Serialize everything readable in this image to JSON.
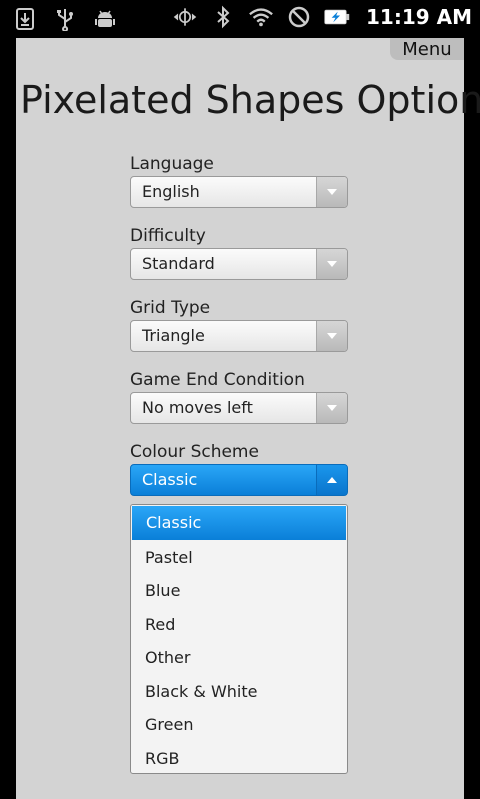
{
  "status_bar": {
    "time": "11:19 AM",
    "left_icons": [
      "download-icon",
      "usb-icon",
      "android-debug-icon"
    ],
    "right_icons": [
      "data-sync-icon",
      "bluetooth-icon",
      "wifi-icon",
      "no-signal-icon",
      "battery-charging-icon"
    ]
  },
  "menu": {
    "label": "Menu"
  },
  "page": {
    "title": "Pixelated Shapes Options"
  },
  "fields": [
    {
      "label": "Language",
      "value": "English"
    },
    {
      "label": "Difficulty",
      "value": "Standard"
    },
    {
      "label": "Grid Type",
      "value": "Triangle"
    },
    {
      "label": "Game End Condition",
      "value": "No moves left"
    },
    {
      "label": "Colour Scheme",
      "value": "Classic"
    }
  ],
  "dropdown": {
    "options": [
      "Classic",
      "Pastel",
      "Blue",
      "Red",
      "Other",
      "Black & White",
      "Green",
      "RGB"
    ],
    "selected": "Classic"
  },
  "colors": {
    "accent": "#0a7fd8",
    "background": "#d3d3d3"
  }
}
